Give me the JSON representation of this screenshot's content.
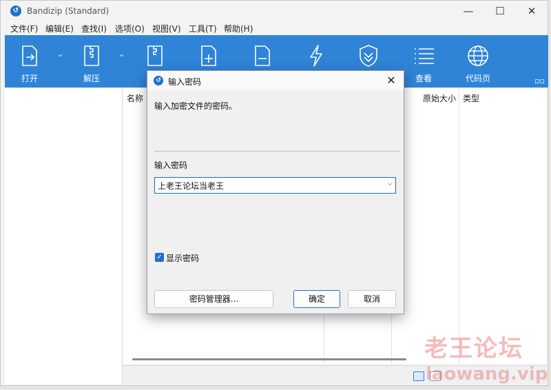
{
  "app": {
    "title": "Bandizip (Standard)"
  },
  "window_controls": {
    "minimize": "—",
    "maximize": "☐",
    "close": "✕"
  },
  "menu": [
    "文件(F)",
    "编辑(E)",
    "查找(I)",
    "选项(O)",
    "视图(V)",
    "工具(T)",
    "帮助(H)"
  ],
  "toolbar": {
    "open": "打开",
    "extract": "解压",
    "view": "查看",
    "codepage": "代码页"
  },
  "list": {
    "columns": {
      "name": "名称",
      "orig_size": "原始大小",
      "type": "类型"
    }
  },
  "dialog": {
    "title": "输入密码",
    "message": "输入加密文件的密码。",
    "label": "输入密码",
    "password_value": "上老王论坛当老王",
    "show_password_label": "显示密码",
    "show_password_checked": true,
    "buttons": {
      "manager": "密码管理器...",
      "ok": "确定",
      "cancel": "取消"
    }
  },
  "watermark": {
    "line1": "老王论坛",
    "line2": "laowang.vip"
  },
  "colors": {
    "accent": "#2f84d8",
    "focus": "#1f6fd1"
  }
}
